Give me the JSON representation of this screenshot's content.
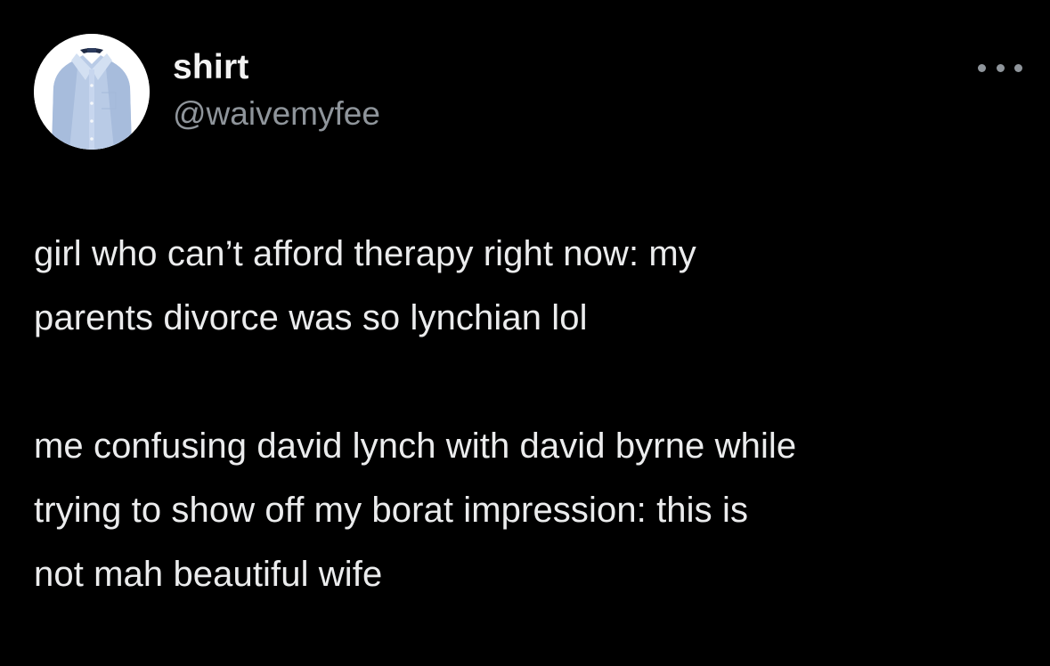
{
  "tweet": {
    "author": {
      "display_name": "shirt",
      "handle": "@waivemyfee",
      "avatar_icon": "dress-shirt-avatar"
    },
    "more_icon": "more-horizontal-icon",
    "paragraphs": [
      "girl who can’t afford therapy right now: my\nparents divorce was so lynchian lol",
      "me confusing david lynch with david byrne while\ntrying to show off my borat impression: this is\nnot mah beautiful wife"
    ]
  },
  "colors": {
    "background": "#000000",
    "primary_text": "#e7e9ea",
    "secondary_text": "#8f959b"
  }
}
